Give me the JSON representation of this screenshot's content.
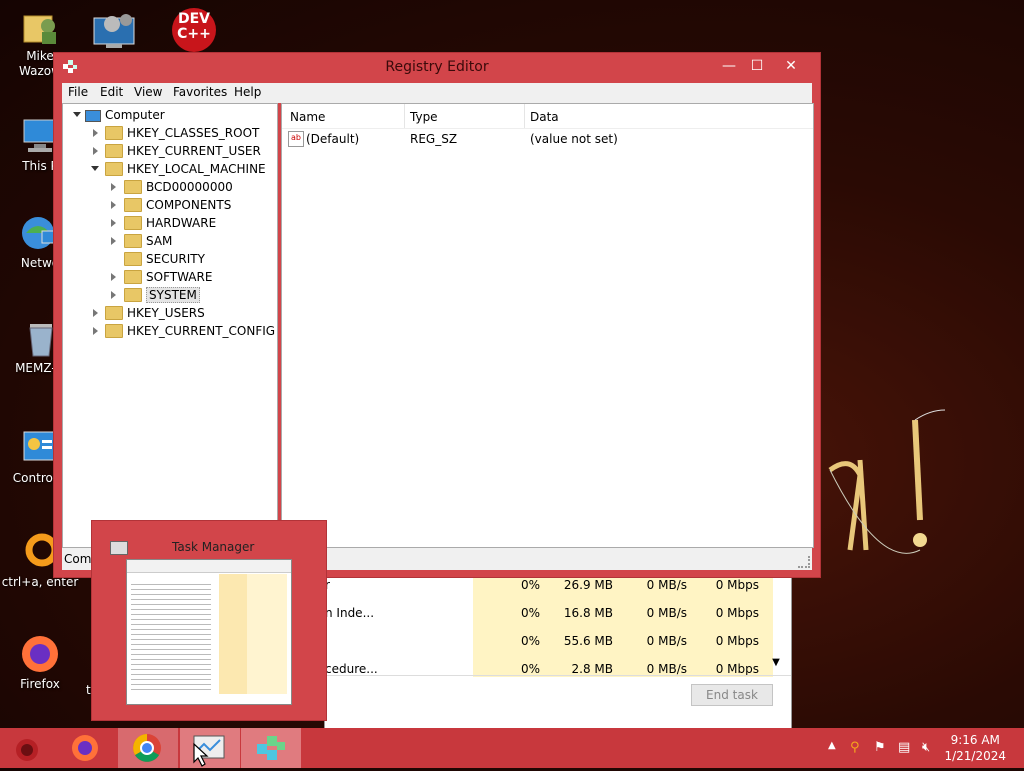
{
  "desktop": {
    "icons": [
      {
        "label": "Mike\nWazow"
      },
      {
        "label": "This P"
      },
      {
        "label": "Netwo"
      },
      {
        "label": "MEMZ-D"
      },
      {
        "label": "Control P"
      },
      {
        "label": "ctrl+a, enter"
      },
      {
        "label": "Firefox"
      }
    ],
    "extra_label": "t",
    "devcpp_text": "DEV\nC++"
  },
  "registry": {
    "title": "Registry Editor",
    "controls": {
      "minimize": "—",
      "maximize": "☐",
      "close": "✕"
    },
    "menu": [
      "File",
      "Edit",
      "View",
      "Favorites",
      "Help"
    ],
    "tree": {
      "root": "Computer",
      "hives": [
        "HKEY_CLASSES_ROOT",
        "HKEY_CURRENT_USER",
        "HKEY_LOCAL_MACHINE"
      ],
      "hklm_children": [
        "BCD00000000",
        "COMPONENTS",
        "HARDWARE",
        "SAM",
        "SECURITY",
        "SOFTWARE",
        "SYSTEM"
      ],
      "hives_after": [
        "HKEY_USERS",
        "HKEY_CURRENT_CONFIG"
      ]
    },
    "list": {
      "headers": [
        "Name",
        "Type",
        "Data"
      ],
      "rows": [
        {
          "name": "(Default)",
          "type": "REG_SZ",
          "data": "(value not set)"
        }
      ]
    },
    "status": "Comp"
  },
  "task_manager": {
    "preview_title": "Task Manager",
    "rows": [
      {
        "name": "r",
        "cpu": "0%",
        "memory": "26.9 MB",
        "disk": "0 MB/s",
        "network": "0 Mbps"
      },
      {
        "name": "n Inde...",
        "cpu": "0%",
        "memory": "16.8 MB",
        "disk": "0 MB/s",
        "network": "0 Mbps"
      },
      {
        "name": "",
        "cpu": "0%",
        "memory": "55.6 MB",
        "disk": "0 MB/s",
        "network": "0 Mbps"
      },
      {
        "name": "cedure...",
        "cpu": "0%",
        "memory": "2.8 MB",
        "disk": "0 MB/s",
        "network": "0 Mbps"
      }
    ],
    "end_task": "End task"
  },
  "taskbar": {
    "clock_time": "9:16 AM",
    "clock_date": "1/21/2024"
  },
  "colors": {
    "accent": "#d2454a",
    "taskbar": "#c8383d"
  }
}
